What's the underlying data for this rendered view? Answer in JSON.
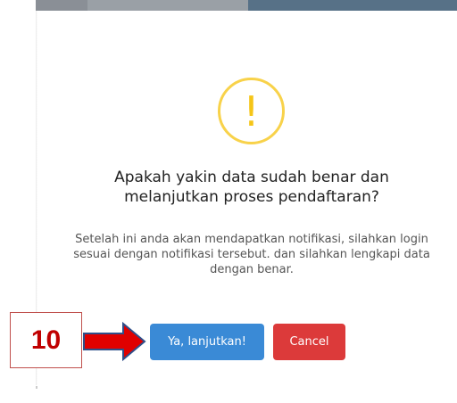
{
  "dialog": {
    "icon": "exclamation-icon",
    "icon_glyph": "!",
    "title": "Apakah yakin data sudah benar dan melanjutkan proses pendaftaran?",
    "message": "Setelah ini anda akan mendapatkan notifikasi, silahkan login sesuai dengan notifikasi tersebut. dan silahkan lengkapi data dengan benar.",
    "confirm_label": "Ya, lanjutkan!",
    "cancel_label": "Cancel"
  },
  "annotation": {
    "step_number": "10",
    "arrow_icon": "arrow-right-icon"
  },
  "colors": {
    "warning": "#f8d24a",
    "confirm": "#3a8ad6",
    "cancel": "#dc3a3a",
    "annotation": "#e00000"
  }
}
